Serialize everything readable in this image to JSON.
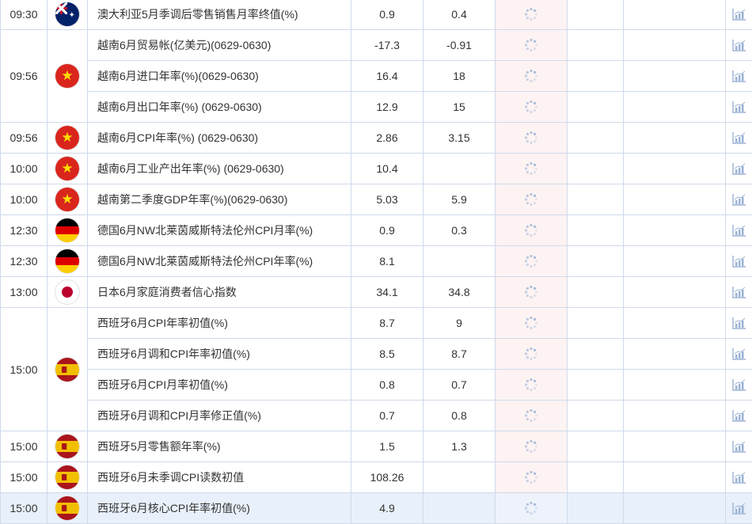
{
  "columns": [
    "time",
    "flag",
    "event",
    "previous",
    "forecast",
    "actual",
    "importance",
    "effect",
    "chart"
  ],
  "rows": [
    {
      "time": "09:30",
      "flag": "australia-flag-icon",
      "event": "澳大利亚5月季调后零售销售月率终值(%)",
      "previous": "0.9",
      "forecast": "0.4"
    },
    {
      "time": "09:56",
      "flag": "vietnam-flag-icon",
      "event": "越南6月贸易帐(亿美元)(0629-0630)",
      "previous": "-17.3",
      "forecast": "-0.91"
    },
    {
      "time": "",
      "flag": "",
      "event": "越南6月进口年率(%)(0629-0630)",
      "previous": "16.4",
      "forecast": "18"
    },
    {
      "time": "",
      "flag": "",
      "event": "越南6月出口年率(%) (0629-0630)",
      "previous": "12.9",
      "forecast": "15"
    },
    {
      "time": "09:56",
      "flag": "vietnam-flag-icon",
      "event": "越南6月CPI年率(%) (0629-0630)",
      "previous": "2.86",
      "forecast": "3.15"
    },
    {
      "time": "10:00",
      "flag": "vietnam-flag-icon",
      "event": "越南6月工业产出年率(%) (0629-0630)",
      "previous": "10.4",
      "forecast": ""
    },
    {
      "time": "10:00",
      "flag": "vietnam-flag-icon",
      "event": "越南第二季度GDP年率(%)(0629-0630)",
      "previous": "5.03",
      "forecast": "5.9"
    },
    {
      "time": "12:30",
      "flag": "germany-flag-icon",
      "event": "德国6月NW北莱茵威斯特法伦州CPI月率(%)",
      "previous": "0.9",
      "forecast": "0.3"
    },
    {
      "time": "12:30",
      "flag": "germany-flag-icon",
      "event": "德国6月NW北莱茵威斯特法伦州CPI年率(%)",
      "previous": "8.1",
      "forecast": ""
    },
    {
      "time": "13:00",
      "flag": "japan-flag-icon",
      "event": "日本6月家庭消费者信心指数",
      "previous": "34.1",
      "forecast": "34.8"
    },
    {
      "time": "15:00",
      "flag": "spain-flag-icon",
      "event": "西班牙6月CPI年率初值(%)",
      "previous": "8.7",
      "forecast": "9"
    },
    {
      "time": "",
      "flag": "",
      "event": "西班牙6月调和CPI年率初值(%)",
      "previous": "8.5",
      "forecast": "8.7"
    },
    {
      "time": "",
      "flag": "",
      "event": "西班牙6月CPI月率初值(%)",
      "previous": "0.8",
      "forecast": "0.7"
    },
    {
      "time": "",
      "flag": "",
      "event": "西班牙6月调和CPI月率修正值(%)",
      "previous": "0.7",
      "forecast": "0.8"
    },
    {
      "time": "15:00",
      "flag": "spain-flag-icon",
      "event": "西班牙5月零售额年率(%)",
      "previous": "1.5",
      "forecast": "1.3"
    },
    {
      "time": "15:00",
      "flag": "spain-flag-icon",
      "event": "西班牙6月未季调CPI读数初值",
      "previous": "108.26",
      "forecast": ""
    },
    {
      "time": "15:00",
      "flag": "spain-flag-icon",
      "event": "西班牙6月核心CPI年率初值(%)",
      "previous": "4.9",
      "forecast": ""
    }
  ],
  "icons": {
    "loading": "loading-spinner-icon",
    "chart": "bar-chart-icon"
  },
  "colors": {
    "border": "#cfdaea",
    "actual_bg": "#fdf3f3",
    "highlight_bg": "#e8f0fb",
    "icon": "#9bb3d4"
  }
}
